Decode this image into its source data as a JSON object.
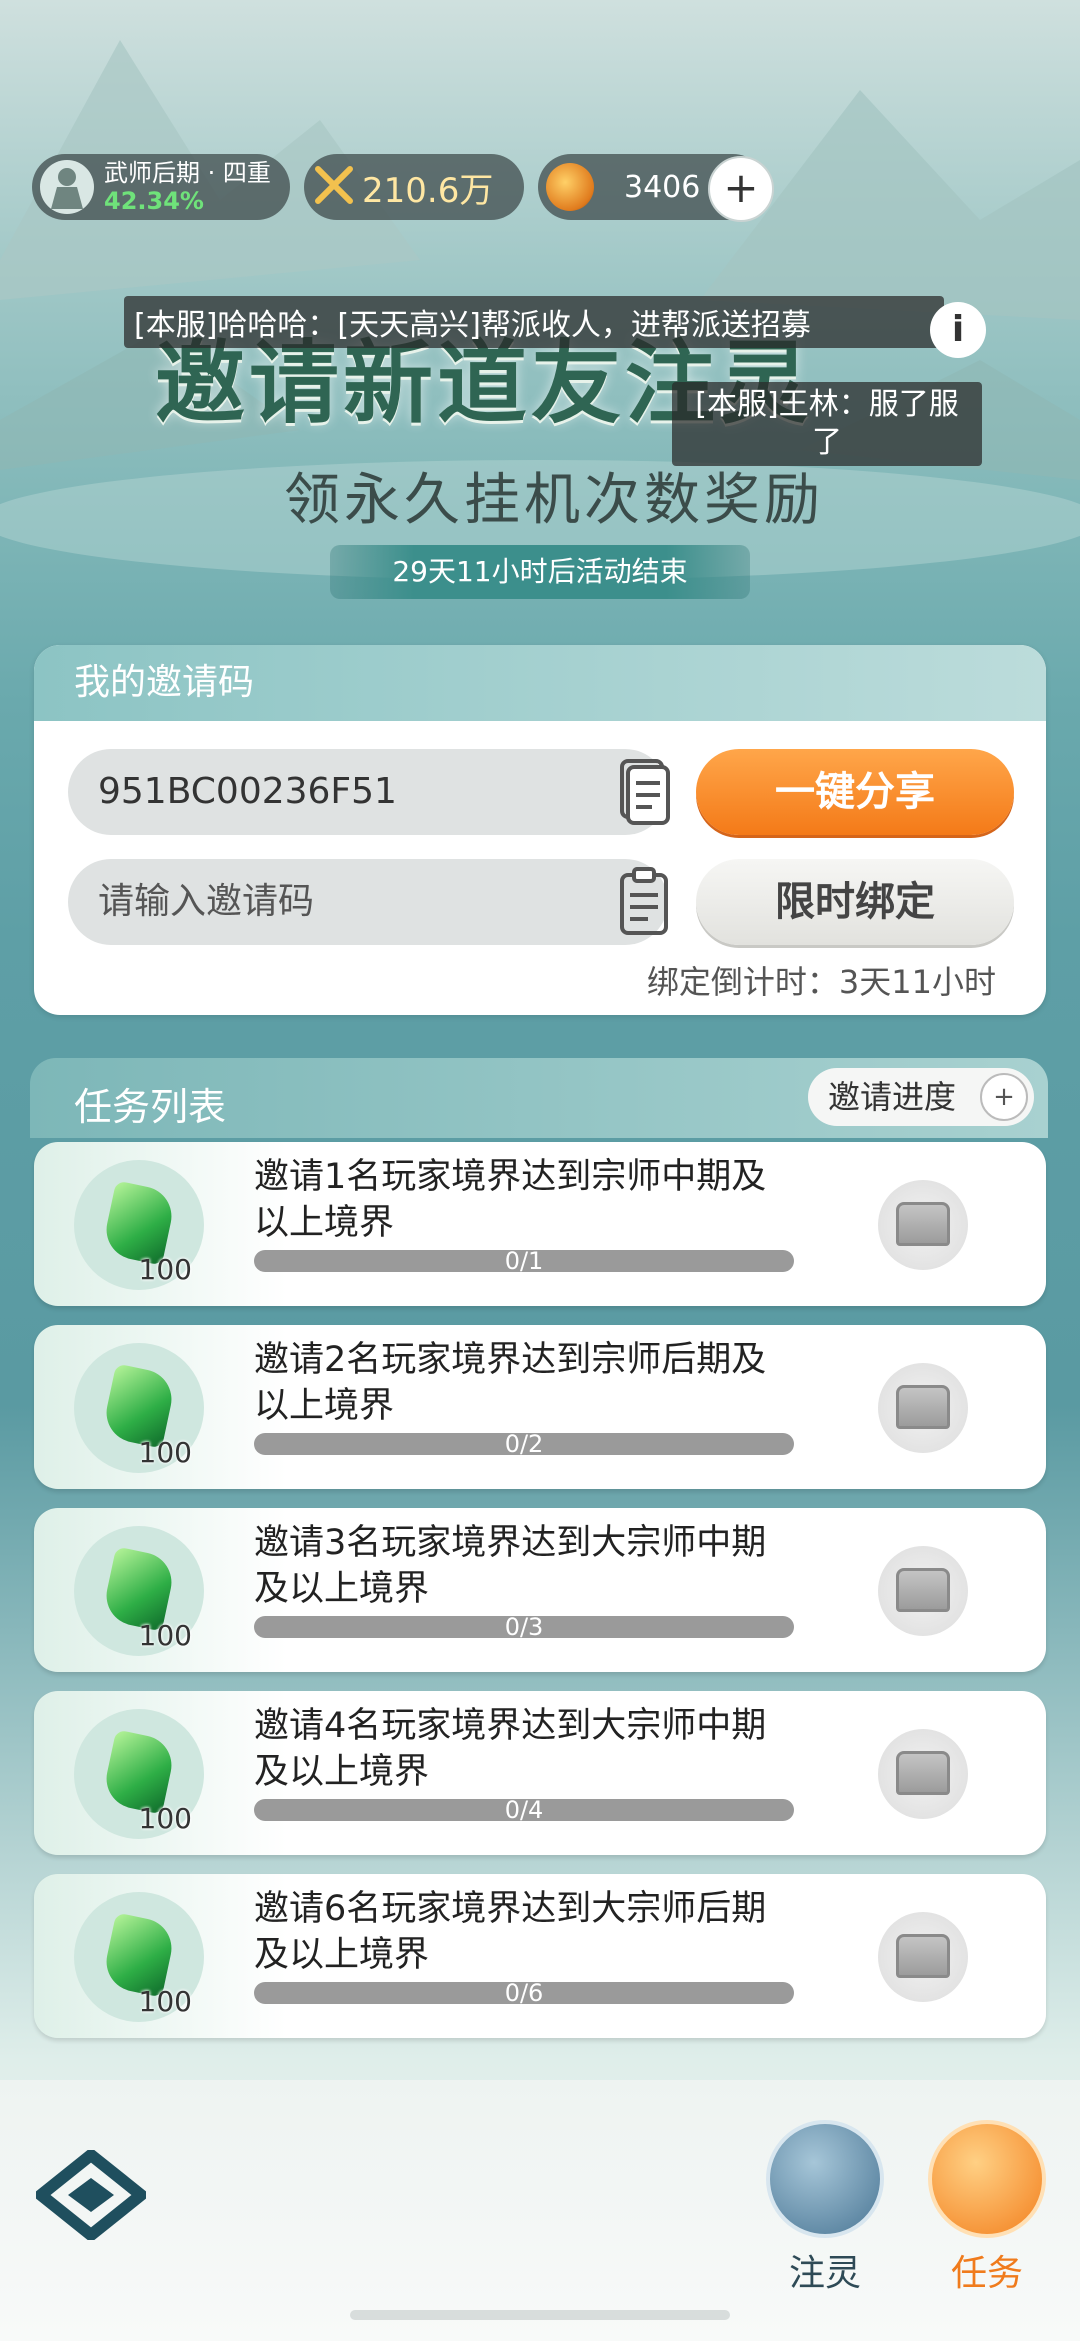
{
  "status": {
    "realm_name": "武师后期 · 四重",
    "realm_progress": "42.34%",
    "power": "210.6万",
    "currency": "3406",
    "plus_label": "+"
  },
  "banner": {
    "title": "邀请新道友注灵",
    "subtitle": "领永久挂机次数奖励",
    "event_timer": "29天11小时后活动结束",
    "info_label": "i"
  },
  "chat": [
    "[本服]哈哈哈：[天天高兴]帮派收人，进帮派送招募",
    "[本服]王林：服了服了"
  ],
  "invite": {
    "header": "我的邀请码",
    "code": "951BC00236F51",
    "share_button": "一键分享",
    "input_placeholder": "请输入邀请码",
    "bind_button": "限时绑定",
    "bind_countdown": "绑定倒计时：3天11小时"
  },
  "tasks": {
    "header": "任务列表",
    "progress_button": "邀请进度",
    "items": [
      {
        "desc": "邀请1名玩家境界达到宗师中期及以上境界",
        "reward": "100",
        "progress": "0/1"
      },
      {
        "desc": "邀请2名玩家境界达到宗师后期及以上境界",
        "reward": "100",
        "progress": "0/2"
      },
      {
        "desc": "邀请3名玩家境界达到大宗师中期及以上境界",
        "reward": "100",
        "progress": "0/3"
      },
      {
        "desc": "邀请4名玩家境界达到大宗师中期及以上境界",
        "reward": "100",
        "progress": "0/4"
      },
      {
        "desc": "邀请6名玩家境界达到大宗师后期及以上境界",
        "reward": "100",
        "progress": "0/6"
      }
    ]
  },
  "nav": {
    "zhuling": "注灵",
    "renwu": "任务"
  },
  "icons": {
    "realm": "warrior-avatar-icon",
    "power": "crossed-swords-icon",
    "currency": "jade-coin-icon",
    "copy": "copy-icon",
    "paste": "paste-icon",
    "reward": "green-jade-gem-icon",
    "chest": "treasure-chest-icon",
    "add_user": "add-user-icon",
    "logo": "game-logo-icon"
  },
  "colors": {
    "accent_orange": "#f47a18",
    "realm_green": "#6fe27a",
    "power_gold": "#ffe7a3",
    "teal_header": "#8cc4c4"
  }
}
